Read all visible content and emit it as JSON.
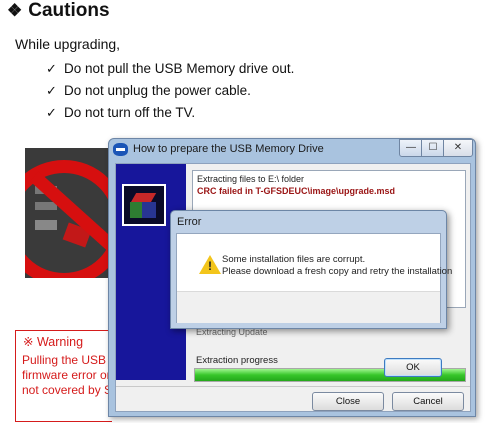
{
  "document": {
    "title": "Cautions",
    "title_bullet": "❖",
    "intro": "While upgrading,",
    "checklist": [
      "Do not pull the USB Memory drive out.",
      "Do not unplug the power cable.",
      "Do not turn off the TV."
    ],
    "warning": {
      "title": "※ Warning",
      "lines": [
        "Pulling the USB M",
        "firmware error or c",
        "not covered by Sa"
      ],
      "color": "#d51b1b"
    }
  },
  "installer_window": {
    "title": "How to prepare the USB Memory Drive",
    "controls": {
      "minimize": "—",
      "maximize": "☐",
      "close": "✕"
    },
    "log_lines": [
      "Extracting files to E:\\ folder",
      "CRC failed in T-GFSDEUC\\image\\upgrade.msd"
    ],
    "status_obscured": "Extracting  Update",
    "progress_label": "Extraction progress",
    "progress_fraction": 1.0,
    "buttons": {
      "close": "Close",
      "cancel": "Cancel"
    },
    "colors": {
      "banner": "#17169b",
      "progress": "#37c62a",
      "error_text": "#9a1414"
    }
  },
  "error_dialog": {
    "title": "Error",
    "icon": "warning-icon",
    "message_lines": [
      "Some installation files are corrupt.",
      "Please download a fresh copy and retry the installation"
    ],
    "ok_label": "OK"
  }
}
